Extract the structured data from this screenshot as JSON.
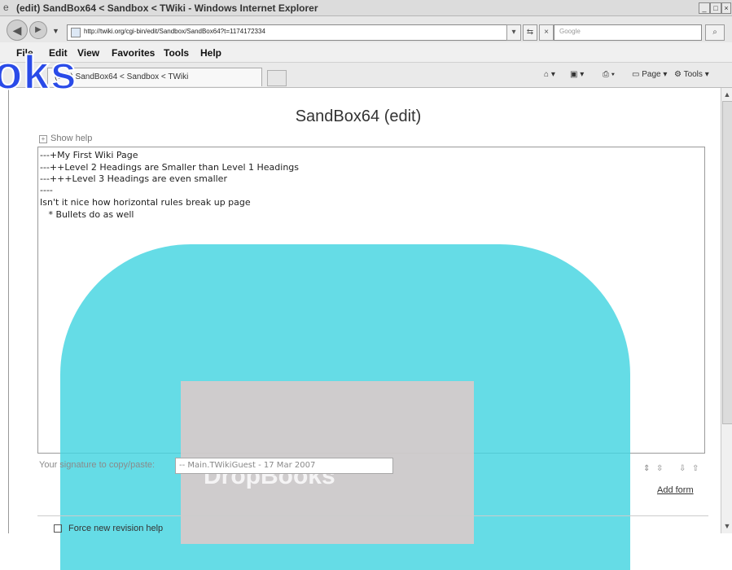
{
  "window": {
    "title": "(edit) SandBox64 < Sandbox < TWiki - Windows Internet Explorer"
  },
  "address": {
    "url": "http://twiki.org/cgi-bin/edit/Sandbox/SandBox64?t=1174172334",
    "search_placeholder": "Google"
  },
  "menu": [
    "File",
    "Edit",
    "View",
    "Favorites",
    "Tools",
    "Help"
  ],
  "tab": {
    "label": "(edit) SandBox64 < Sandbox < TWiki"
  },
  "commands": {
    "page": "Page",
    "tools": "Tools"
  },
  "watermark": {
    "text": "oks",
    "word": "DropBooks"
  },
  "page": {
    "title": "SandBox64 (edit)",
    "show_help": "Show help",
    "editor_lines": [
      "---+My First Wiki Page",
      "---++Level 2 Headings are Smaller than Level 1 Headings",
      "---+++Level 3 Headings are even smaller",
      "----",
      "Isn't it nice how horizontal rules break up page",
      "   * Bullets do as well"
    ],
    "signature_label": "Your signature to copy/paste:",
    "signature_value": "-- Main.TWikiGuest - 17 Mar 2007",
    "add_form": "Add form",
    "force_revision": "Force new revision help"
  }
}
